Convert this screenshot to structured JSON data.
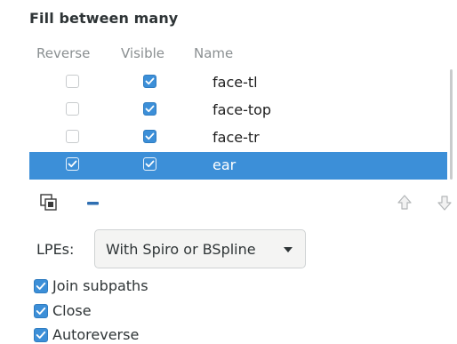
{
  "panel": {
    "title": "Fill between many"
  },
  "table": {
    "columns": {
      "reverse": "Reverse",
      "visible": "Visible",
      "name": "Name"
    },
    "rows": [
      {
        "name": "face-tl",
        "reverse": false,
        "visible": true,
        "selected": false
      },
      {
        "name": "face-top",
        "reverse": false,
        "visible": true,
        "selected": false
      },
      {
        "name": "face-tr",
        "reverse": false,
        "visible": true,
        "selected": false
      },
      {
        "name": "ear",
        "reverse": true,
        "visible": true,
        "selected": true
      }
    ]
  },
  "toolbar": {
    "icons": [
      "duplicate-icon",
      "remove-icon",
      "move-up-icon",
      "move-down-icon"
    ]
  },
  "lpe": {
    "label": "LPEs:",
    "selected": "With Spiro or BSpline"
  },
  "options": {
    "join_subpaths": {
      "label": "Join subpaths",
      "checked": true
    },
    "close": {
      "label": "Close",
      "checked": true
    },
    "autoreverse": {
      "label": "Autoreverse",
      "checked": true
    }
  },
  "colors": {
    "accent": "#3c8fd8",
    "header_text": "#8a8f91",
    "text": "#2e3436"
  }
}
